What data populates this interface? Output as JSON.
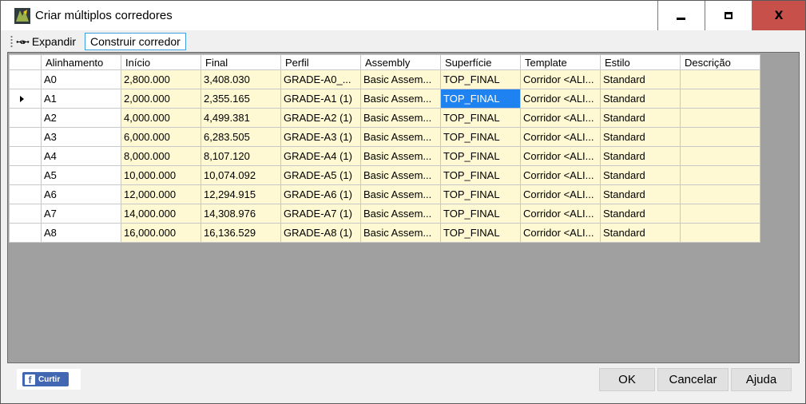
{
  "window": {
    "title": "Criar múltiplos corredores",
    "close_glyph": "X"
  },
  "toolbar": {
    "expand_label": "Expandir",
    "expand_icon": "↤a↦",
    "build_label": "Construir corredor"
  },
  "grid": {
    "columns": [
      "Alinhamento",
      "Início",
      "Final",
      "Perfil",
      "Assembly",
      "Superfície",
      "Template",
      "Estilo",
      "Descrição"
    ],
    "selected_row": 1,
    "selected_column": 5,
    "rows": [
      {
        "alinhamento": "A0",
        "inicio": "2,800.000",
        "final": "3,408.030",
        "perfil": "GRADE-A0_...",
        "assembly": "Basic Assem...",
        "superficie": "TOP_FINAL",
        "template": "Corridor <ALI...",
        "estilo": "Standard",
        "descricao": ""
      },
      {
        "alinhamento": "A1",
        "inicio": "2,000.000",
        "final": "2,355.165",
        "perfil": "GRADE-A1 (1)",
        "assembly": "Basic Assem...",
        "superficie": "TOP_FINAL",
        "template": "Corridor <ALI...",
        "estilo": "Standard",
        "descricao": ""
      },
      {
        "alinhamento": "A2",
        "inicio": "4,000.000",
        "final": "4,499.381",
        "perfil": "GRADE-A2 (1)",
        "assembly": "Basic Assem...",
        "superficie": "TOP_FINAL",
        "template": "Corridor <ALI...",
        "estilo": "Standard",
        "descricao": ""
      },
      {
        "alinhamento": "A3",
        "inicio": "6,000.000",
        "final": "6,283.505",
        "perfil": "GRADE-A3 (1)",
        "assembly": "Basic Assem...",
        "superficie": "TOP_FINAL",
        "template": "Corridor <ALI...",
        "estilo": "Standard",
        "descricao": ""
      },
      {
        "alinhamento": "A4",
        "inicio": "8,000.000",
        "final": "8,107.120",
        "perfil": "GRADE-A4 (1)",
        "assembly": "Basic Assem...",
        "superficie": "TOP_FINAL",
        "template": "Corridor <ALI...",
        "estilo": "Standard",
        "descricao": ""
      },
      {
        "alinhamento": "A5",
        "inicio": "10,000.000",
        "final": "10,074.092",
        "perfil": "GRADE-A5 (1)",
        "assembly": "Basic Assem...",
        "superficie": "TOP_FINAL",
        "template": "Corridor <ALI...",
        "estilo": "Standard",
        "descricao": ""
      },
      {
        "alinhamento": "A6",
        "inicio": "12,000.000",
        "final": "12,294.915",
        "perfil": "GRADE-A6 (1)",
        "assembly": "Basic Assem...",
        "superficie": "TOP_FINAL",
        "template": "Corridor <ALI...",
        "estilo": "Standard",
        "descricao": ""
      },
      {
        "alinhamento": "A7",
        "inicio": "14,000.000",
        "final": "14,308.976",
        "perfil": "GRADE-A7 (1)",
        "assembly": "Basic Assem...",
        "superficie": "TOP_FINAL",
        "template": "Corridor <ALI...",
        "estilo": "Standard",
        "descricao": ""
      },
      {
        "alinhamento": "A8",
        "inicio": "16,000.000",
        "final": "16,136.529",
        "perfil": "GRADE-A8 (1)",
        "assembly": "Basic Assem...",
        "superficie": "TOP_FINAL",
        "template": "Corridor <ALI...",
        "estilo": "Standard",
        "descricao": ""
      }
    ]
  },
  "footer": {
    "facebook_label": "Curtir",
    "ok_label": "OK",
    "cancel_label": "Cancelar",
    "help_label": "Ajuda"
  },
  "colors": {
    "editable_cell": "#fef9d2",
    "selected_cell": "#1e82f0",
    "grid_background": "#a0a0a0",
    "close_button": "#c7504a",
    "facebook_blue": "#4267b2"
  },
  "icons": {
    "app": "app-icon",
    "expand": "expand-icon",
    "facebook": "facebook-icon",
    "row_indicator": "row-arrow-icon"
  }
}
